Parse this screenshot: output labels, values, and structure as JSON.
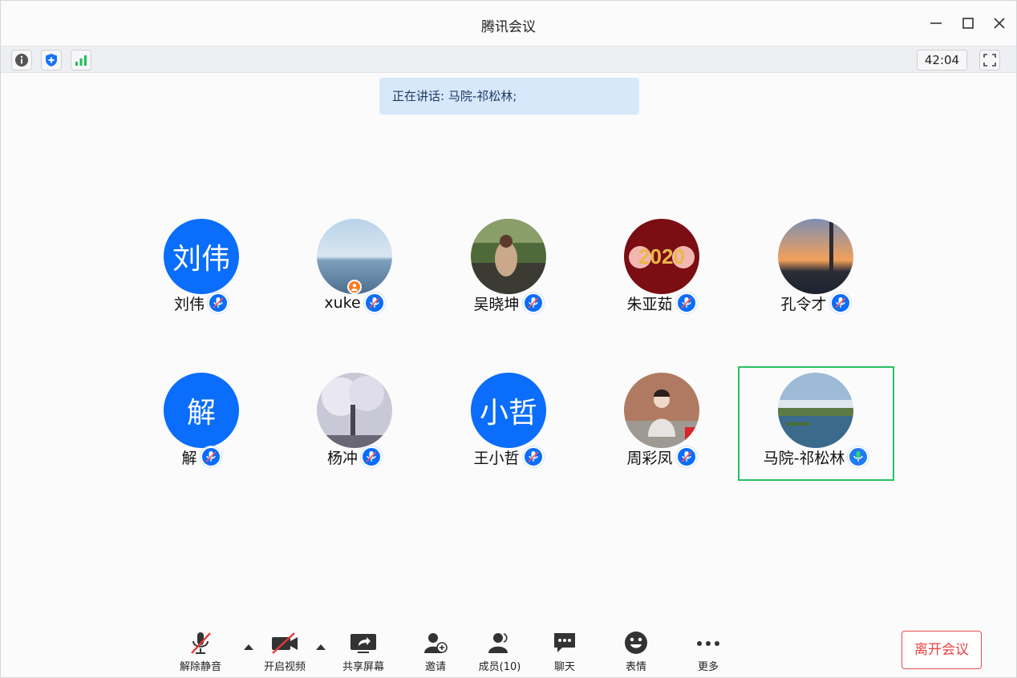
{
  "window": {
    "title": "腾讯会议"
  },
  "infobar": {
    "timer": "42:04"
  },
  "speaking": {
    "text": "正在讲话: 马院-祁松林;"
  },
  "participants": [
    {
      "name": "刘伟",
      "avatar_text": "刘伟",
      "mic": "muted"
    },
    {
      "name": "xuke",
      "avatar_text": "",
      "mic": "muted",
      "host": true
    },
    {
      "name": "吴晓坤",
      "avatar_text": "",
      "mic": "muted"
    },
    {
      "name": "朱亚茹",
      "avatar_text": "",
      "mic": "muted"
    },
    {
      "name": "孔令才",
      "avatar_text": "",
      "mic": "muted"
    },
    {
      "name": "解",
      "avatar_text": "解",
      "mic": "muted"
    },
    {
      "name": "杨冲",
      "avatar_text": "",
      "mic": "muted"
    },
    {
      "name": "王小哲",
      "avatar_text": "小哲",
      "mic": "muted"
    },
    {
      "name": "周彩凤",
      "avatar_text": "",
      "mic": "muted"
    },
    {
      "name": "马院-祁松林",
      "avatar_text": "",
      "mic": "speaking",
      "active": true
    }
  ],
  "controls": {
    "unmute": "解除静音",
    "video": "开启视频",
    "share": "共享屏幕",
    "invite": "邀请",
    "members": "成员(10)",
    "chat": "聊天",
    "emoji": "表情",
    "more": "更多",
    "leave": "离开会议"
  },
  "colors": {
    "accent": "#0a6dfb",
    "speaking_border": "#27c160",
    "leave": "#e84343",
    "banner": "#d8e8fb"
  }
}
